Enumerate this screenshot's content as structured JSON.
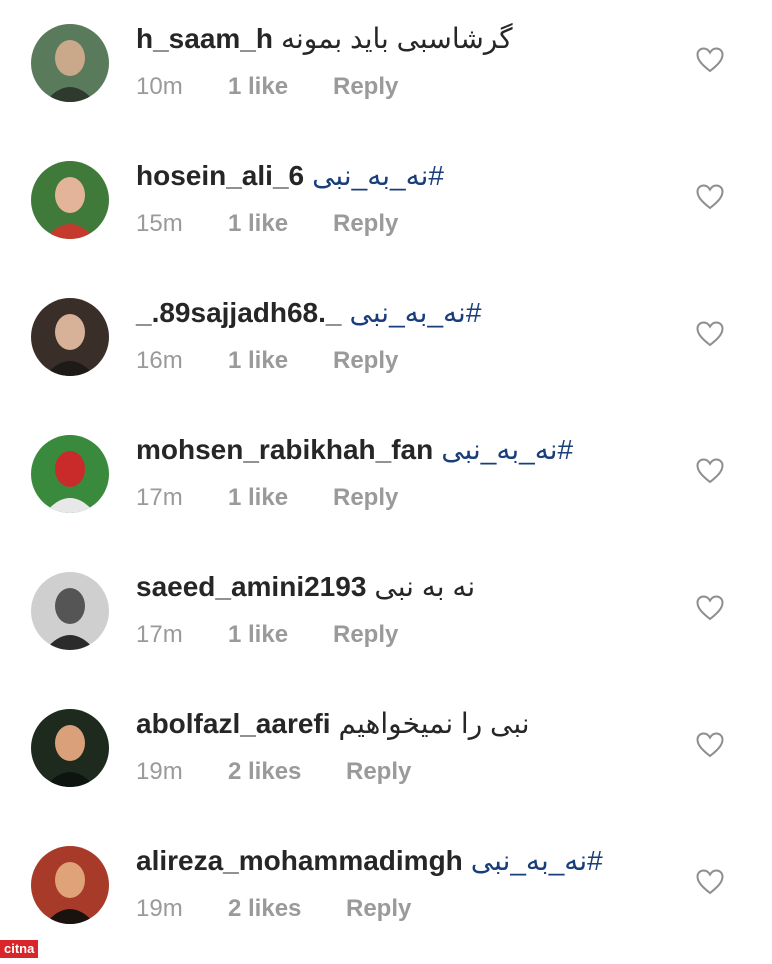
{
  "comments": [
    {
      "username": "h_saam_h",
      "text": "گرشاسبی باید بمونه",
      "is_hashtag": false,
      "time": "10m",
      "likes": "1 like",
      "reply": "Reply",
      "avatar_icon": "avatar-photo"
    },
    {
      "username": "hosein_ali_6",
      "text": "#نه_به_نبی",
      "is_hashtag": true,
      "time": "15m",
      "likes": "1 like",
      "reply": "Reply",
      "avatar_icon": "avatar-photo"
    },
    {
      "username": "_.89sajjadh68._",
      "text": "#نه_به_نبی",
      "is_hashtag": true,
      "time": "16m",
      "likes": "1 like",
      "reply": "Reply",
      "avatar_icon": "avatar-photo"
    },
    {
      "username": "mohsen_rabikhah_fan",
      "text": "#نه_به_نبی",
      "is_hashtag": true,
      "time": "17m",
      "likes": "1 like",
      "reply": "Reply",
      "avatar_icon": "avatar-photo"
    },
    {
      "username": "saeed_amini2193",
      "text": "نه به نبی",
      "is_hashtag": false,
      "time": "17m",
      "likes": "1 like",
      "reply": "Reply",
      "avatar_icon": "avatar-photo"
    },
    {
      "username": "abolfazl_aarefi",
      "text": "نبی را نمیخواهیم",
      "is_hashtag": false,
      "time": "19m",
      "likes": "2 likes",
      "reply": "Reply",
      "avatar_icon": "avatar-photo"
    },
    {
      "username": "alireza_mohammadimgh",
      "text": "#نه_به_نبی",
      "is_hashtag": true,
      "time": "19m",
      "likes": "2 likes",
      "reply": "Reply",
      "avatar_icon": "avatar-photo"
    }
  ],
  "watermark": "citna",
  "colors": {
    "text": "#262626",
    "meta": "#9a9a9a",
    "hashtag": "#1a3e7a",
    "heart": "#8e8e8e",
    "watermark_bg": "#d8262b"
  },
  "icons": {
    "like": "heart-outline-icon"
  }
}
